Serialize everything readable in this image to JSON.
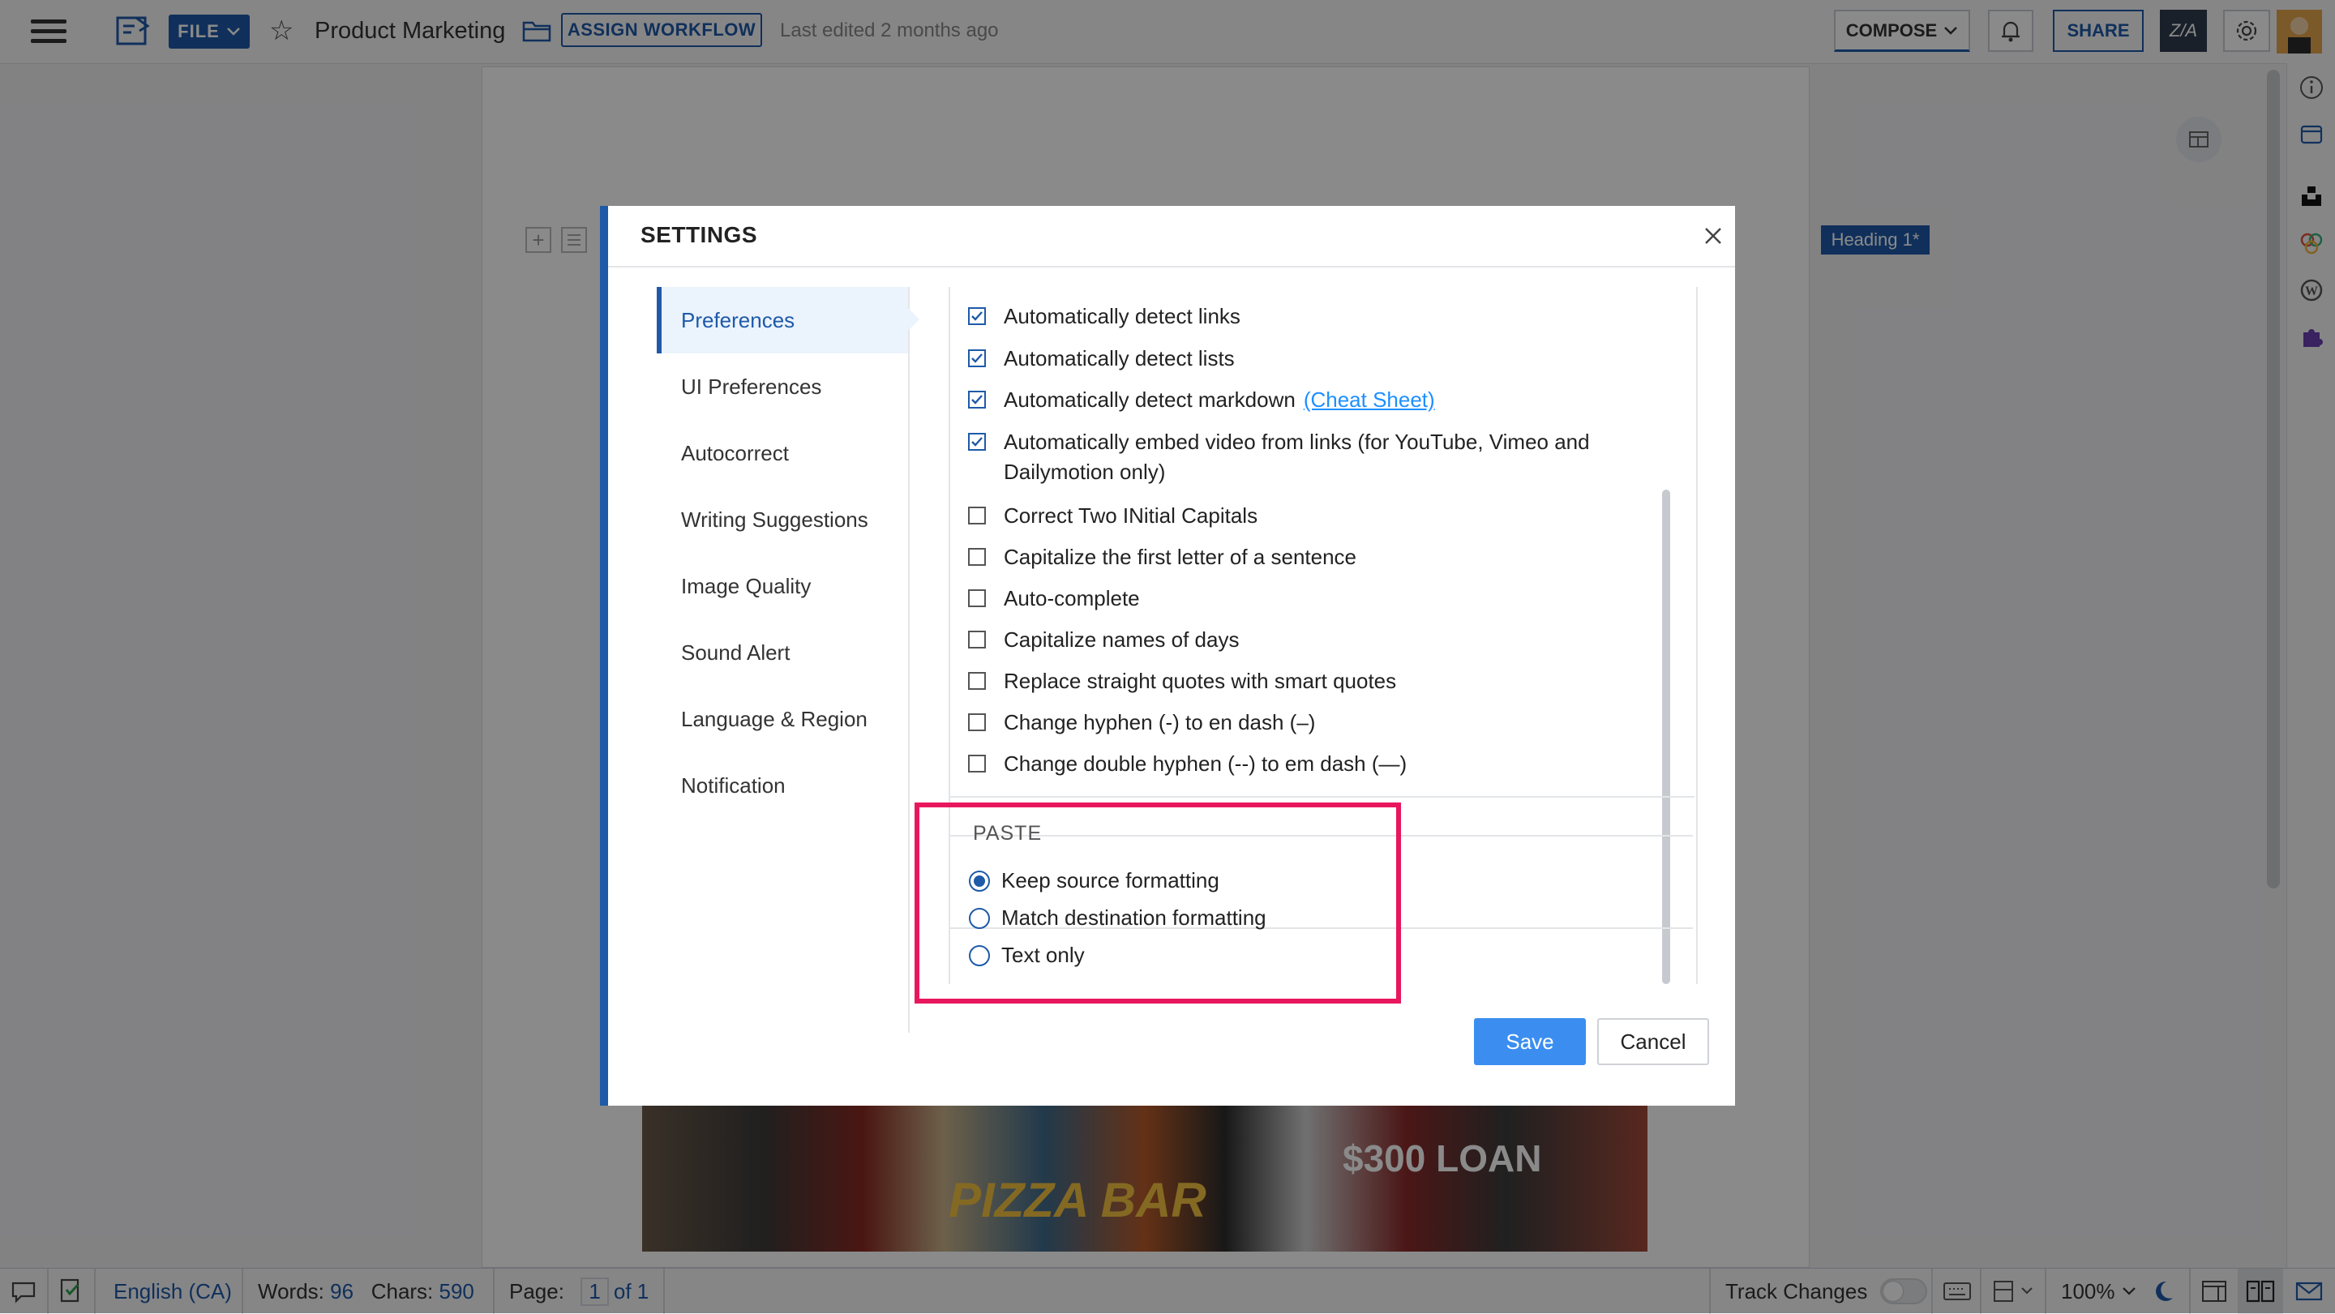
{
  "topbar": {
    "file_label": "FILE",
    "doc_title": "Product Marketing",
    "assign_label": "ASSIGN WORKFLOW",
    "last_edited": "Last edited 2 months ago",
    "compose_label": "COMPOSE",
    "share_label": "SHARE",
    "zoho_label": "Z/A"
  },
  "document": {
    "heading_chip": "Heading 1*",
    "image_text_1": "$300 LOAN",
    "image_text_2": "PIZZA BAR"
  },
  "settings": {
    "title": "SETTINGS",
    "nav": [
      {
        "label": "Preferences",
        "active": true
      },
      {
        "label": "UI Preferences"
      },
      {
        "label": "Autocorrect"
      },
      {
        "label": "Writing Suggestions"
      },
      {
        "label": "Image Quality"
      },
      {
        "label": "Sound Alert"
      },
      {
        "label": "Language & Region"
      },
      {
        "label": "Notification"
      }
    ],
    "options": [
      {
        "label": "Automatically detect links",
        "checked": true
      },
      {
        "label": "Automatically detect lists",
        "checked": true
      },
      {
        "label": "Automatically detect markdown",
        "link": "(Cheat Sheet)",
        "checked": true
      },
      {
        "label": "Automatically embed video from links (for YouTube, Vimeo and Dailymotion only)",
        "checked": true
      },
      {
        "label": "Correct Two INitial Capitals",
        "checked": false
      },
      {
        "label": "Capitalize the first letter of a sentence",
        "checked": false
      },
      {
        "label": "Auto-complete",
        "checked": false
      },
      {
        "label": "Capitalize names of days",
        "checked": false
      },
      {
        "label": "Replace straight quotes with smart quotes",
        "checked": false
      },
      {
        "label": "Change hyphen (-) to en dash (–)",
        "checked": false
      },
      {
        "label": "Change double hyphen (--) to em dash (—)",
        "checked": false
      }
    ],
    "paste": {
      "legend": "PASTE",
      "options": [
        {
          "label": "Keep source formatting",
          "selected": true
        },
        {
          "label": "Match destination formatting",
          "selected": false
        },
        {
          "label": "Text only",
          "selected": false
        }
      ]
    },
    "save_label": "Save",
    "cancel_label": "Cancel"
  },
  "statusbar": {
    "language": "English (CA)",
    "words_label": "Words:",
    "words_value": "96",
    "chars_label": "Chars:",
    "chars_value": "590",
    "page_label": "Page:",
    "page_current": "1",
    "page_total": "of 1",
    "track_changes": "Track Changes",
    "zoom": "100%"
  },
  "colors": {
    "accent": "#1e5aa8",
    "highlight": "#e8175d",
    "save": "#3b8ef0"
  }
}
